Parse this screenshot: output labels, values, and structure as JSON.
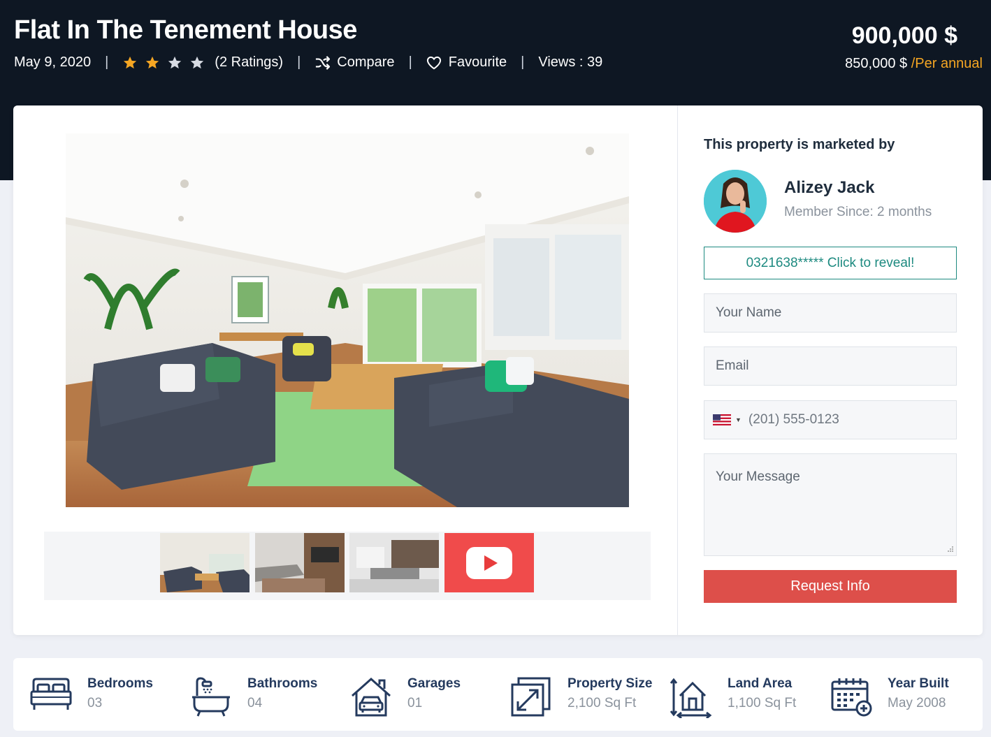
{
  "listing": {
    "title": "Flat In The Tenement House",
    "date": "May 9, 2020",
    "rating": {
      "stars_filled": 2,
      "stars_total": 4,
      "ratings_text": "(2 Ratings)"
    },
    "compare_label": "Compare",
    "favourite_label": "Favourite",
    "views_label": "Views : 39",
    "separator": "|",
    "price": "900,000 $",
    "sub_price": "850,000 $",
    "per_period": "/Per annual",
    "accent_color": "#f5a623",
    "header_bg": "#0e1723"
  },
  "gallery": {
    "thumbnails": [
      "living-room-thumb",
      "lounge-thumb",
      "kitchen-thumb"
    ],
    "video_icon": "youtube-play-icon",
    "video_color": "#f04b4b"
  },
  "agent": {
    "heading": "This property is marketed by",
    "name": "Alizey Jack",
    "member_since": "Member Since: 2 months",
    "reveal_phone": "0321638***** Click to reveal!",
    "reveal_color": "#1d8a80"
  },
  "form": {
    "name_placeholder": "Your Name",
    "email_placeholder": "Email",
    "phone_placeholder": "(201) 555-0123",
    "message_placeholder": "Your Message",
    "submit_label": "Request Info",
    "submit_color": "#dd4f4a"
  },
  "features": [
    {
      "icon": "bed-icon",
      "label": "Bedrooms",
      "value": "03"
    },
    {
      "icon": "bathtub-icon",
      "label": "Bathrooms",
      "value": "04"
    },
    {
      "icon": "garage-icon",
      "label": "Garages",
      "value": "01"
    },
    {
      "icon": "expand-icon",
      "label": "Property Size",
      "value": "2,100 Sq Ft"
    },
    {
      "icon": "land-area-icon",
      "label": "Land Area",
      "value": "1,100 Sq Ft"
    },
    {
      "icon": "calendar-icon",
      "label": "Year Built",
      "value": "May 2008"
    }
  ]
}
